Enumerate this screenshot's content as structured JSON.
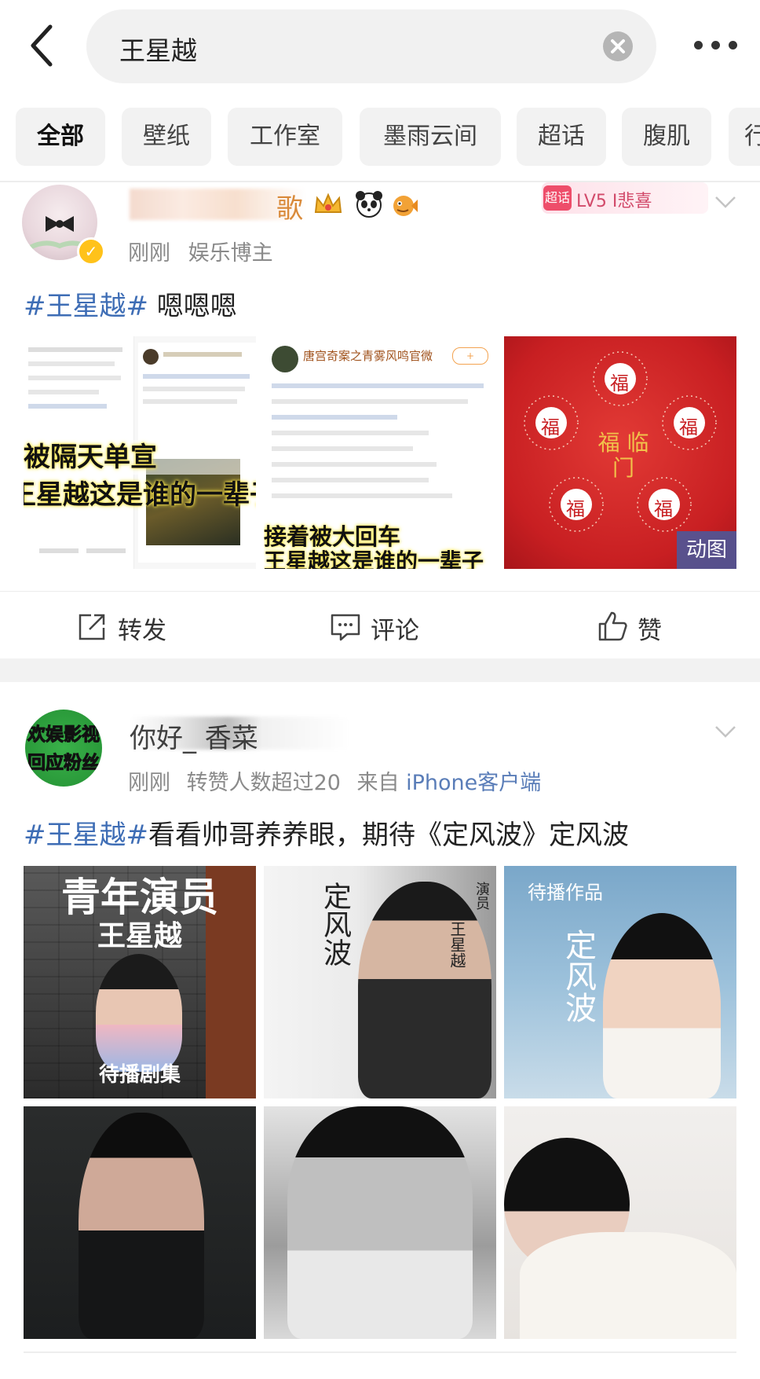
{
  "search": {
    "query": "王星越"
  },
  "tabs": [
    "全部",
    "壁纸",
    "工作室",
    "墨雨云间",
    "超话",
    "腹肌",
    "行"
  ],
  "post1": {
    "username": "歌",
    "meta_time": "刚刚",
    "meta_role": "娱乐博主",
    "level_badge": "LV5 I悲喜",
    "text": {
      "hashtag": "#王星越#",
      "body": " 嗯嗯嗯"
    },
    "images": [
      {
        "caption_top": "被隔天单宣",
        "caption_bottom": "王星越这是谁的一辈子"
      },
      {
        "caption_top": "唐宫奇案之青雾风鸣官微",
        "caption_bottom": "接着被大回车",
        "caption_bottom2": "王星越这是谁的一辈子"
      },
      {
        "badge": "动图",
        "seal": "福",
        "center_text": "福 临门"
      }
    ],
    "actions": {
      "repost": "转发",
      "comment": "评论",
      "like": "赞"
    }
  },
  "post2": {
    "username": "你好_ 香菜",
    "avatar_text": "欢娱影视 回应粉丝",
    "meta_time": "刚刚",
    "meta_info": "转赞人数超过20",
    "meta_from": "来自",
    "meta_client": "iPhone客户端",
    "text": {
      "hashtag": "#王星越#",
      "body": "看看帅哥养养眼，期待《定风波》定风波"
    },
    "images": [
      {
        "caption_top": "青年演员",
        "caption_name": "王星越",
        "caption_bottom": "待播剧集"
      },
      {
        "caption_top": "演员",
        "caption_name": "王星越"
      },
      {
        "caption_top": "待播作品",
        "caption_name": "定风波"
      },
      {},
      {},
      {}
    ]
  },
  "colors": {
    "hashtag": "#3e6db5",
    "link": "#5a7db8",
    "verified": "#ffc21a",
    "gif_badge": "#465aa0"
  }
}
